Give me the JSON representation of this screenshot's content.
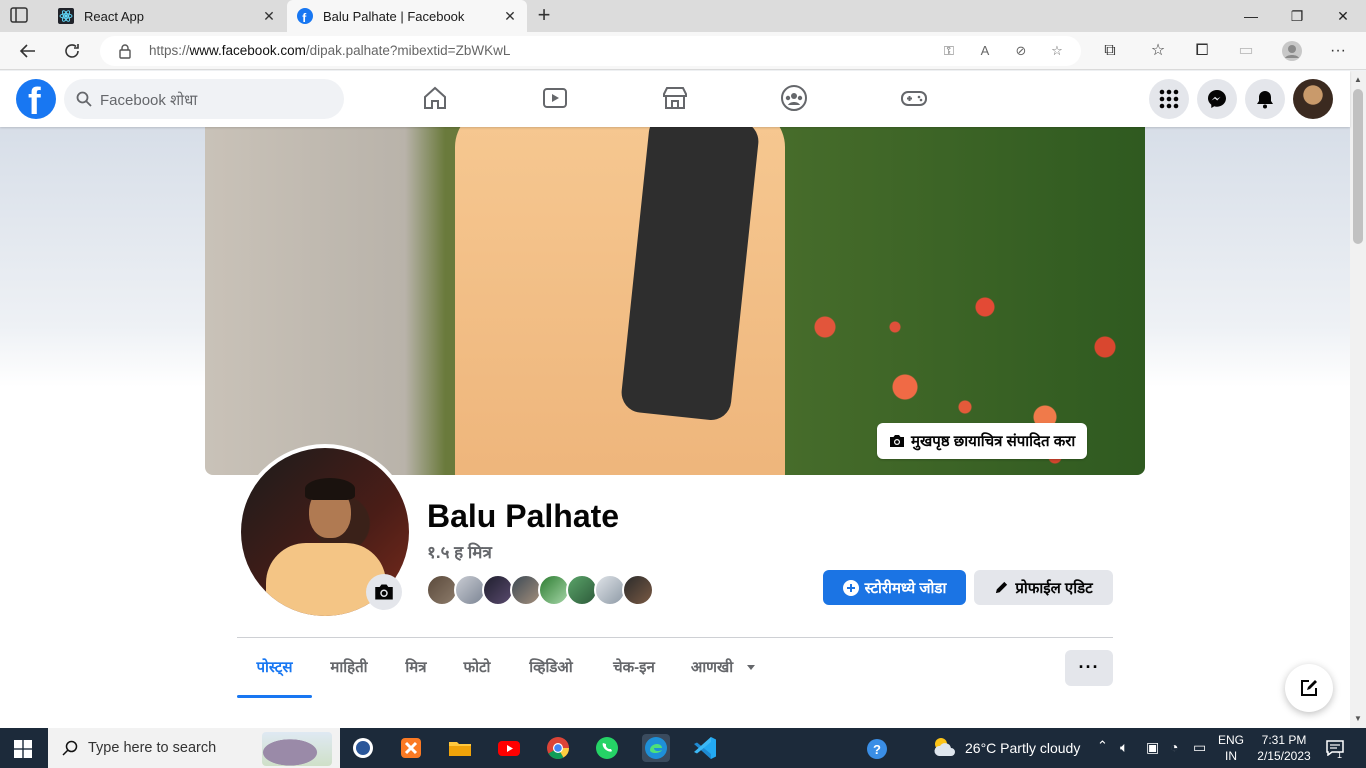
{
  "browser": {
    "tabs": [
      {
        "title": "React App",
        "icon": "react-icon",
        "active": false
      },
      {
        "title": "Balu Palhate | Facebook",
        "icon": "facebook-icon",
        "active": true
      }
    ],
    "new_tab_label": "+",
    "url_prefix": "https://",
    "url_host": "www.facebook.com",
    "url_path": "/dipak.palhate?mibextid=ZbWKwL"
  },
  "facebook": {
    "search_placeholder": "Facebook शोधा",
    "nav_icons": [
      "home-icon",
      "watch-icon",
      "marketplace-icon",
      "groups-icon",
      "gaming-icon"
    ],
    "right_icons": [
      "menu-grid-icon",
      "messenger-icon",
      "notifications-icon"
    ],
    "brand_color": "#1877f2"
  },
  "profile": {
    "name": "Balu Palhate",
    "friends": "१.५ ह मित्र",
    "edit_cover": "मुखपृष्ठ छायाचित्र संपादित करा",
    "add_story": "स्टोरीमध्ये जोडा",
    "edit_profile": "प्रोफाईल एडिट",
    "friend_thumbs_count": 8,
    "tabs": [
      {
        "label": "पोस्ट्स",
        "active": true
      },
      {
        "label": "माहिती",
        "active": false
      },
      {
        "label": "मित्र",
        "active": false
      },
      {
        "label": "फोटो",
        "active": false
      },
      {
        "label": "व्हिडिओ",
        "active": false
      },
      {
        "label": "चेक-इन",
        "active": false
      },
      {
        "label": "आणखी",
        "active": false
      }
    ],
    "more_label": "···"
  },
  "taskbar": {
    "search_placeholder": "Type here to search",
    "weather": "26°C  Partly cloudy",
    "lang_top": "ENG",
    "lang_bottom": "IN",
    "time": "7:31 PM",
    "date": "2/15/2023",
    "notification_count": "1"
  }
}
